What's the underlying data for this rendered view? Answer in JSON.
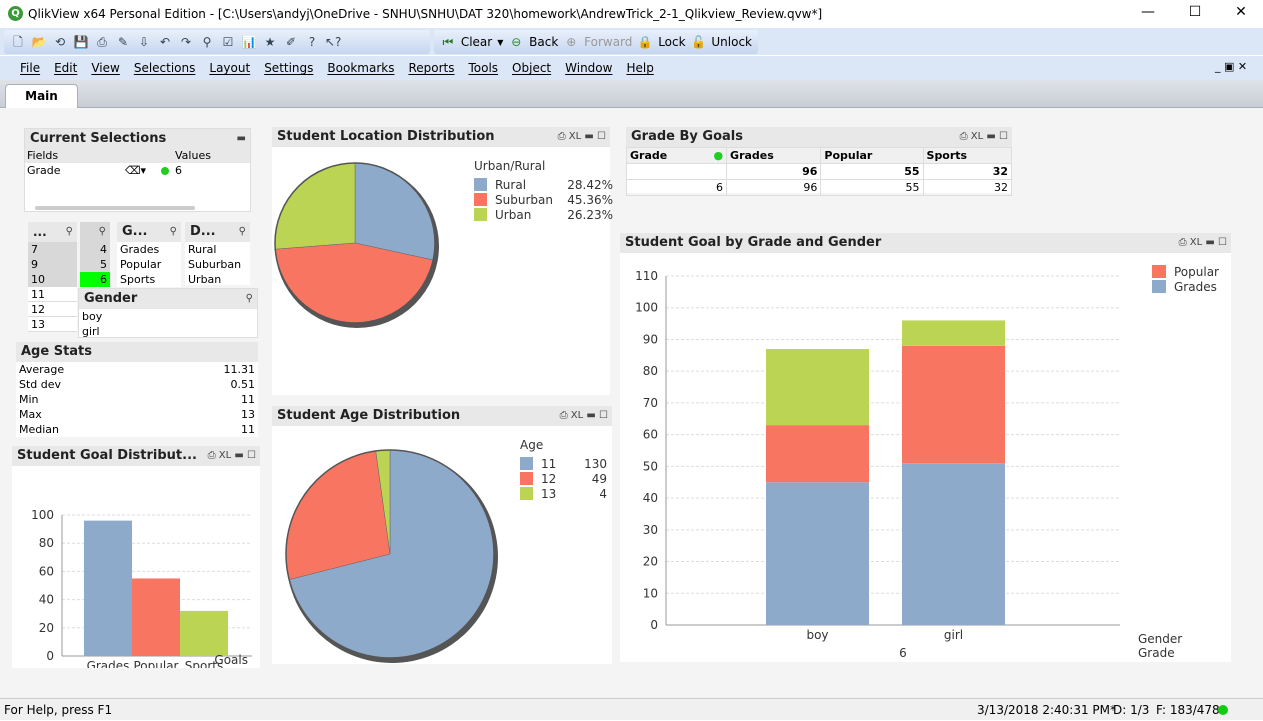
{
  "window": {
    "title": "QlikView x64 Personal Edition - [C:\\Users\\andyj\\OneDrive - SNHU\\SNHU\\DAT 320\\homework\\AndrewTrick_2-1_Qlikview_Review.qvw*]",
    "logo": "Q",
    "minimize": "—",
    "maximize": "☐",
    "close": "✕"
  },
  "toolbar": {
    "clear": "Clear",
    "back": "Back",
    "forward": "Forward",
    "lock": "Lock",
    "unlock": "Unlock",
    "icons": [
      "new-icon",
      "open-icon",
      "reload-icon",
      "save-icon",
      "print-icon",
      "edit-script-icon",
      "reload-data-icon",
      "undo-icon",
      "redo-icon",
      "search-icon",
      "checkbox-icon",
      "chart-icon",
      "star-icon",
      "edit-icon",
      "help-icon",
      "context-help-icon"
    ]
  },
  "menu": [
    "File",
    "Edit",
    "View",
    "Selections",
    "Layout",
    "Settings",
    "Bookmarks",
    "Reports",
    "Tools",
    "Object",
    "Window",
    "Help"
  ],
  "tabs": [
    "Main"
  ],
  "current_selections": {
    "title": "Current Selections",
    "col_fields": "Fields",
    "col_values": "Values",
    "rows": [
      {
        "field": "Grade",
        "value": "6"
      }
    ]
  },
  "listboxes": {
    "age": {
      "title": "...",
      "values": [
        "7",
        "9",
        "10",
        "11",
        "12",
        "13"
      ]
    },
    "grade": {
      "title": "",
      "values": [
        "4",
        "5",
        "6"
      ],
      "selected": "6"
    },
    "goals": {
      "title": "G...",
      "values": [
        "Grades",
        "Popular",
        "Sports"
      ]
    },
    "district": {
      "title": "D...",
      "values": [
        "Rural",
        "Suburban",
        "Urban"
      ]
    },
    "gender": {
      "title": "Gender",
      "values": [
        "boy",
        "girl"
      ]
    }
  },
  "age_stats": {
    "title": "Age Stats",
    "rows": [
      {
        "label": "Average",
        "value": "11.31"
      },
      {
        "label": "Std dev",
        "value": "0.51"
      },
      {
        "label": "Min",
        "value": "11"
      },
      {
        "label": "Max",
        "value": "13"
      },
      {
        "label": "Median",
        "value": "11"
      }
    ]
  },
  "colors": {
    "blue": "#8eaacb",
    "red": "#f87562",
    "green": "#bcd454",
    "selected": "#00ff00"
  },
  "grade_by_goals": {
    "title": "Grade By Goals",
    "headers": [
      "Grade",
      "Grades",
      "Popular",
      "Sports"
    ],
    "totals": [
      "",
      "96",
      "55",
      "32"
    ],
    "rows": [
      [
        "6",
        "96",
        "55",
        "32"
      ]
    ]
  },
  "chart_data": [
    {
      "type": "pie",
      "title": "Student Location Distribution",
      "legend_title": "Urban/Rural",
      "categories": [
        "Rural",
        "Suburban",
        "Urban"
      ],
      "labels": [
        "28.42%",
        "45.36%",
        "26.23%"
      ],
      "values": [
        28.42,
        45.36,
        26.23
      ]
    },
    {
      "type": "pie",
      "title": "Student Age Distribution",
      "legend_title": "Age",
      "categories": [
        "11",
        "12",
        "13"
      ],
      "labels": [
        "130",
        "49",
        "4"
      ],
      "values": [
        130,
        49,
        4
      ]
    },
    {
      "type": "bar",
      "title": "Student Goal Distribut...",
      "xlabel": "Goals",
      "categories": [
        "Grades",
        "Popular",
        "Sports"
      ],
      "values": [
        96,
        55,
        32
      ],
      "ylim": [
        0,
        100
      ],
      "yticks": [
        "0",
        "20",
        "40",
        "60",
        "80",
        "100"
      ],
      "grid": true
    },
    {
      "type": "bar",
      "stacked": true,
      "title": "Student Goal by Grade and Gender",
      "xlabel": "Gender",
      "xlabel2": "Grade",
      "xsub": "6",
      "categories": [
        "boy",
        "girl"
      ],
      "series": [
        {
          "name": "Grades",
          "values": [
            45,
            51
          ]
        },
        {
          "name": "Popular",
          "values": [
            18,
            37
          ]
        },
        {
          "name": "Sports",
          "values": [
            24,
            8
          ]
        }
      ],
      "legend": [
        "Popular",
        "Grades"
      ],
      "ylim": [
        0,
        110
      ],
      "yticks": [
        "0",
        "10",
        "20",
        "30",
        "40",
        "50",
        "60",
        "70",
        "80",
        "90",
        "100",
        "110"
      ],
      "grid": true
    }
  ],
  "status": {
    "help": "For Help, press F1",
    "timestamp": "3/13/2018 2:40:31 PM*",
    "d": "D: 1/3",
    "f": "F: 183/478"
  }
}
